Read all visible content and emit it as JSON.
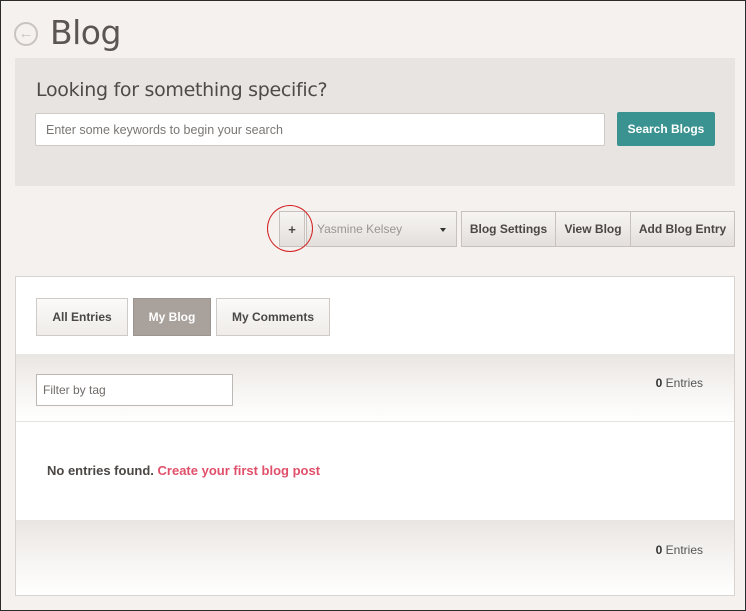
{
  "header": {
    "title": "Blog",
    "back_icon": "back-arrow-icon"
  },
  "search": {
    "heading": "Looking for something specific?",
    "placeholder": "Enter some keywords to begin your search",
    "value": "",
    "button_label": "Search Blogs",
    "button_color": "#3a9390"
  },
  "toolbar": {
    "plus_label": "+",
    "user_select": "Yasmine Kelsey",
    "blog_settings": "Blog Settings",
    "view_blog": "View Blog",
    "add_blog_entry": "Add Blog Entry",
    "highlight_color": "#d42020"
  },
  "tabs": [
    {
      "label": "All Entries",
      "active": false
    },
    {
      "label": "My Blog",
      "active": true
    },
    {
      "label": "My Comments",
      "active": false
    }
  ],
  "filter": {
    "placeholder": "Filter by tag",
    "value": ""
  },
  "entries": {
    "count": "0",
    "label": "Entries"
  },
  "empty_state": {
    "message": "No entries found.",
    "link": "Create your first blog post",
    "link_color": "#e0506a"
  }
}
